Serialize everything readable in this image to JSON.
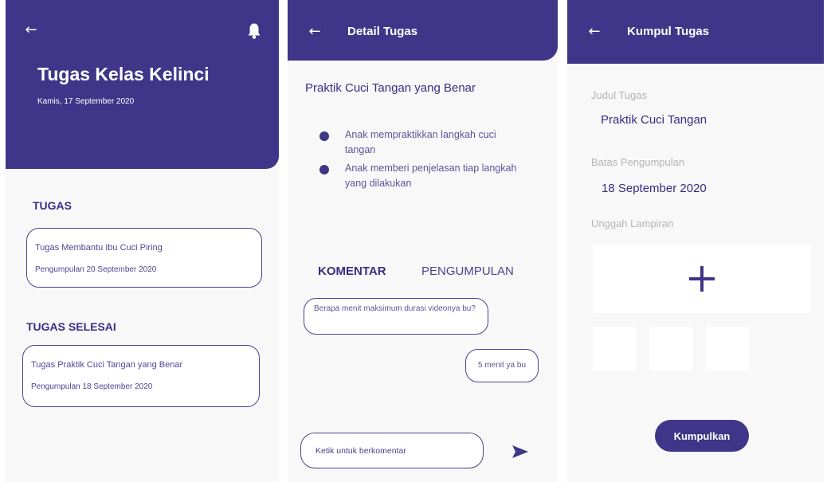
{
  "screen1": {
    "title": "Tugas Kelas Kelinci",
    "date": "Kamis, 17 September 2020",
    "tugas_label": "TUGAS",
    "tugas_card": {
      "title": "Tugas Membantu Ibu Cuci Piring",
      "deadline": "Pengumpulan 20 September 2020"
    },
    "selesai_label": "TUGAS SELESAI",
    "selesai_card": {
      "title": "Tugas Praktik Cuci Tangan yang Benar",
      "deadline": "Pengumpulan 18 September 2020"
    }
  },
  "screen2": {
    "header_title": "Detail Tugas",
    "task_title": "Praktik Cuci Tangan yang Benar",
    "objectives": [
      "Anak mempraktikkan langkah cuci tangan",
      "Anak memberi penjelasan tiap langkah yang dilakukan"
    ],
    "tabs": {
      "komentar": "KOMENTAR",
      "pengumpulan": "PENGUMPULAN"
    },
    "comments": [
      "Berapa menit maksimum durasi videonya bu?",
      "5 menit ya bu"
    ],
    "comment_placeholder": "Ketik untuk berkomentar"
  },
  "screen3": {
    "header_title": "Kumpul Tugas",
    "judul_label": "Judul Tugas",
    "judul_value": "Praktik Cuci Tangan",
    "batas_label": "Batas Pengumpulan",
    "batas_value": "18 September 2020",
    "lampiran_label": "Unggah Lampiran",
    "submit_label": "Kumpulkan"
  },
  "icons": {
    "back": "arrow-left-icon",
    "notification": "bell-icon",
    "send": "send-icon",
    "add": "plus-icon"
  },
  "colors": {
    "primary": "#3f3689",
    "text_primary": "#3a2d86",
    "background": "#f8f8f8",
    "label_gray": "#b5b5b5"
  }
}
